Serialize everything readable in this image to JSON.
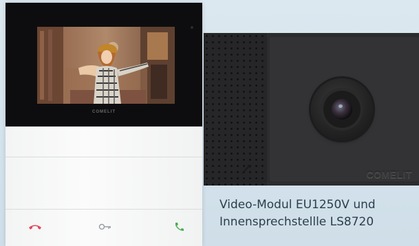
{
  "indoor_station": {
    "brand_logo": "COMELIT",
    "buttons": [
      {
        "icon": "phone-hangup-icon",
        "color": "#e04a5a"
      },
      {
        "icon": "key-icon",
        "color": "#9aa0a6"
      },
      {
        "icon": "phone-answer-icon",
        "color": "#4caf50"
      }
    ]
  },
  "video_module": {
    "brand_logo": "COMELIT"
  },
  "caption": {
    "line1": "Video-Modul EU1250V und",
    "line2": "Innensprechstellle LS8720"
  }
}
